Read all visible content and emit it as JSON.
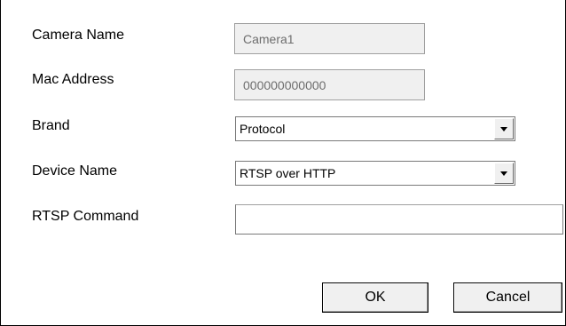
{
  "fields": {
    "camera_name": {
      "label": "Camera Name",
      "value": "Camera1"
    },
    "mac_address": {
      "label": "Mac Address",
      "value": "000000000000"
    },
    "brand": {
      "label": "Brand",
      "selected": "Protocol"
    },
    "device_name": {
      "label": "Device Name",
      "selected": "RTSP over HTTP"
    },
    "rtsp_command": {
      "label": "RTSP Command",
      "value": ""
    }
  },
  "buttons": {
    "ok": "OK",
    "cancel": "Cancel"
  },
  "icons": {
    "dropdown": "chevron-down-icon"
  }
}
